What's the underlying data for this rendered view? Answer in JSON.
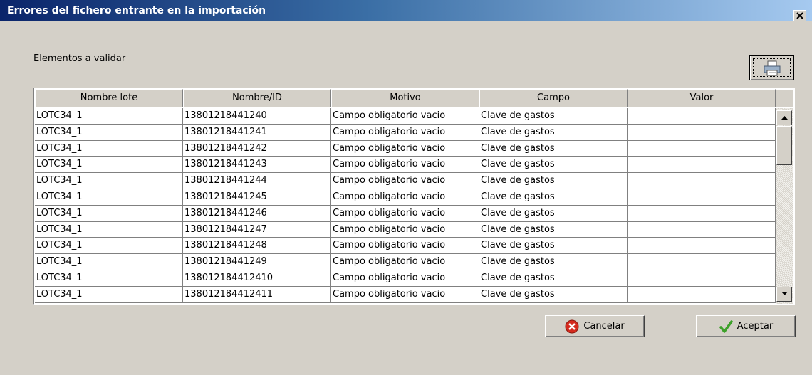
{
  "window": {
    "title": "Errores del fichero entrante en la importación",
    "close_icon": "close-icon"
  },
  "section_label": "Elementos a validar",
  "print_icon": "printer-icon",
  "table": {
    "columns": [
      "Nombre lote",
      "Nombre/ID",
      "Motivo",
      "Campo",
      "Valor"
    ],
    "rows": [
      [
        "LOTC34_1",
        "13801218441240",
        "Campo obligatorio vacio",
        "Clave de gastos",
        ""
      ],
      [
        "LOTC34_1",
        "13801218441241",
        "Campo obligatorio vacio",
        "Clave de gastos",
        ""
      ],
      [
        "LOTC34_1",
        "13801218441242",
        "Campo obligatorio vacio",
        "Clave de gastos",
        ""
      ],
      [
        "LOTC34_1",
        "13801218441243",
        "Campo obligatorio vacio",
        "Clave de gastos",
        ""
      ],
      [
        "LOTC34_1",
        "13801218441244",
        "Campo obligatorio vacio",
        "Clave de gastos",
        ""
      ],
      [
        "LOTC34_1",
        "13801218441245",
        "Campo obligatorio vacio",
        "Clave de gastos",
        ""
      ],
      [
        "LOTC34_1",
        "13801218441246",
        "Campo obligatorio vacio",
        "Clave de gastos",
        ""
      ],
      [
        "LOTC34_1",
        "13801218441247",
        "Campo obligatorio vacio",
        "Clave de gastos",
        ""
      ],
      [
        "LOTC34_1",
        "13801218441248",
        "Campo obligatorio vacio",
        "Clave de gastos",
        ""
      ],
      [
        "LOTC34_1",
        "13801218441249",
        "Campo obligatorio vacio",
        "Clave de gastos",
        ""
      ],
      [
        "LOTC34_1",
        "138012184412410",
        "Campo obligatorio vacio",
        "Clave de gastos",
        ""
      ],
      [
        "LOTC34_1",
        "138012184412411",
        "Campo obligatorio vacio",
        "Clave de gastos",
        ""
      ]
    ]
  },
  "buttons": {
    "cancel_label": "Cancelar",
    "cancel_icon": "cancel-x-icon",
    "accept_label": "Aceptar",
    "accept_icon": "checkmark-icon"
  },
  "colors": {
    "titlebar_start": "#0a246a",
    "titlebar_end": "#a6caf0",
    "dialog_bg": "#d4d0c8",
    "cancel_icon": "#d42a1e",
    "accept_icon": "#3da12a"
  }
}
